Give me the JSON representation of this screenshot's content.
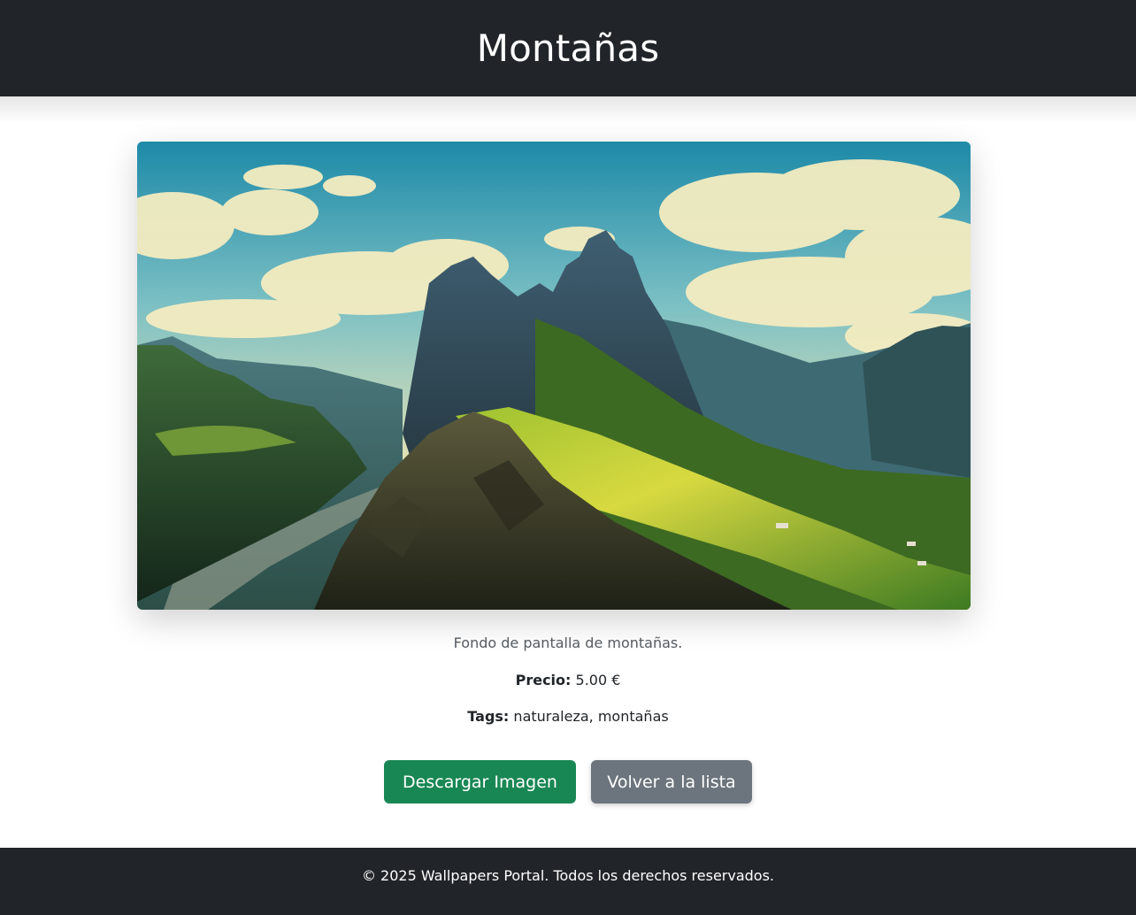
{
  "header": {
    "title": "Montañas"
  },
  "wallpaper": {
    "image_alt": "Montañas",
    "description": "Fondo de pantalla de montañas.",
    "price_label": "Precio:",
    "price_value": "5.00 €",
    "tags_label": "Tags:",
    "tags_value": "naturaleza, montañas"
  },
  "actions": {
    "download_label": "Descargar Imagen",
    "back_label": "Volver a la lista"
  },
  "footer": {
    "text": "© 2025 Wallpapers Portal. Todos los derechos reservados."
  },
  "colors": {
    "header_bg": "#212529",
    "download_button": "#198754",
    "back_button": "#6c757d"
  }
}
